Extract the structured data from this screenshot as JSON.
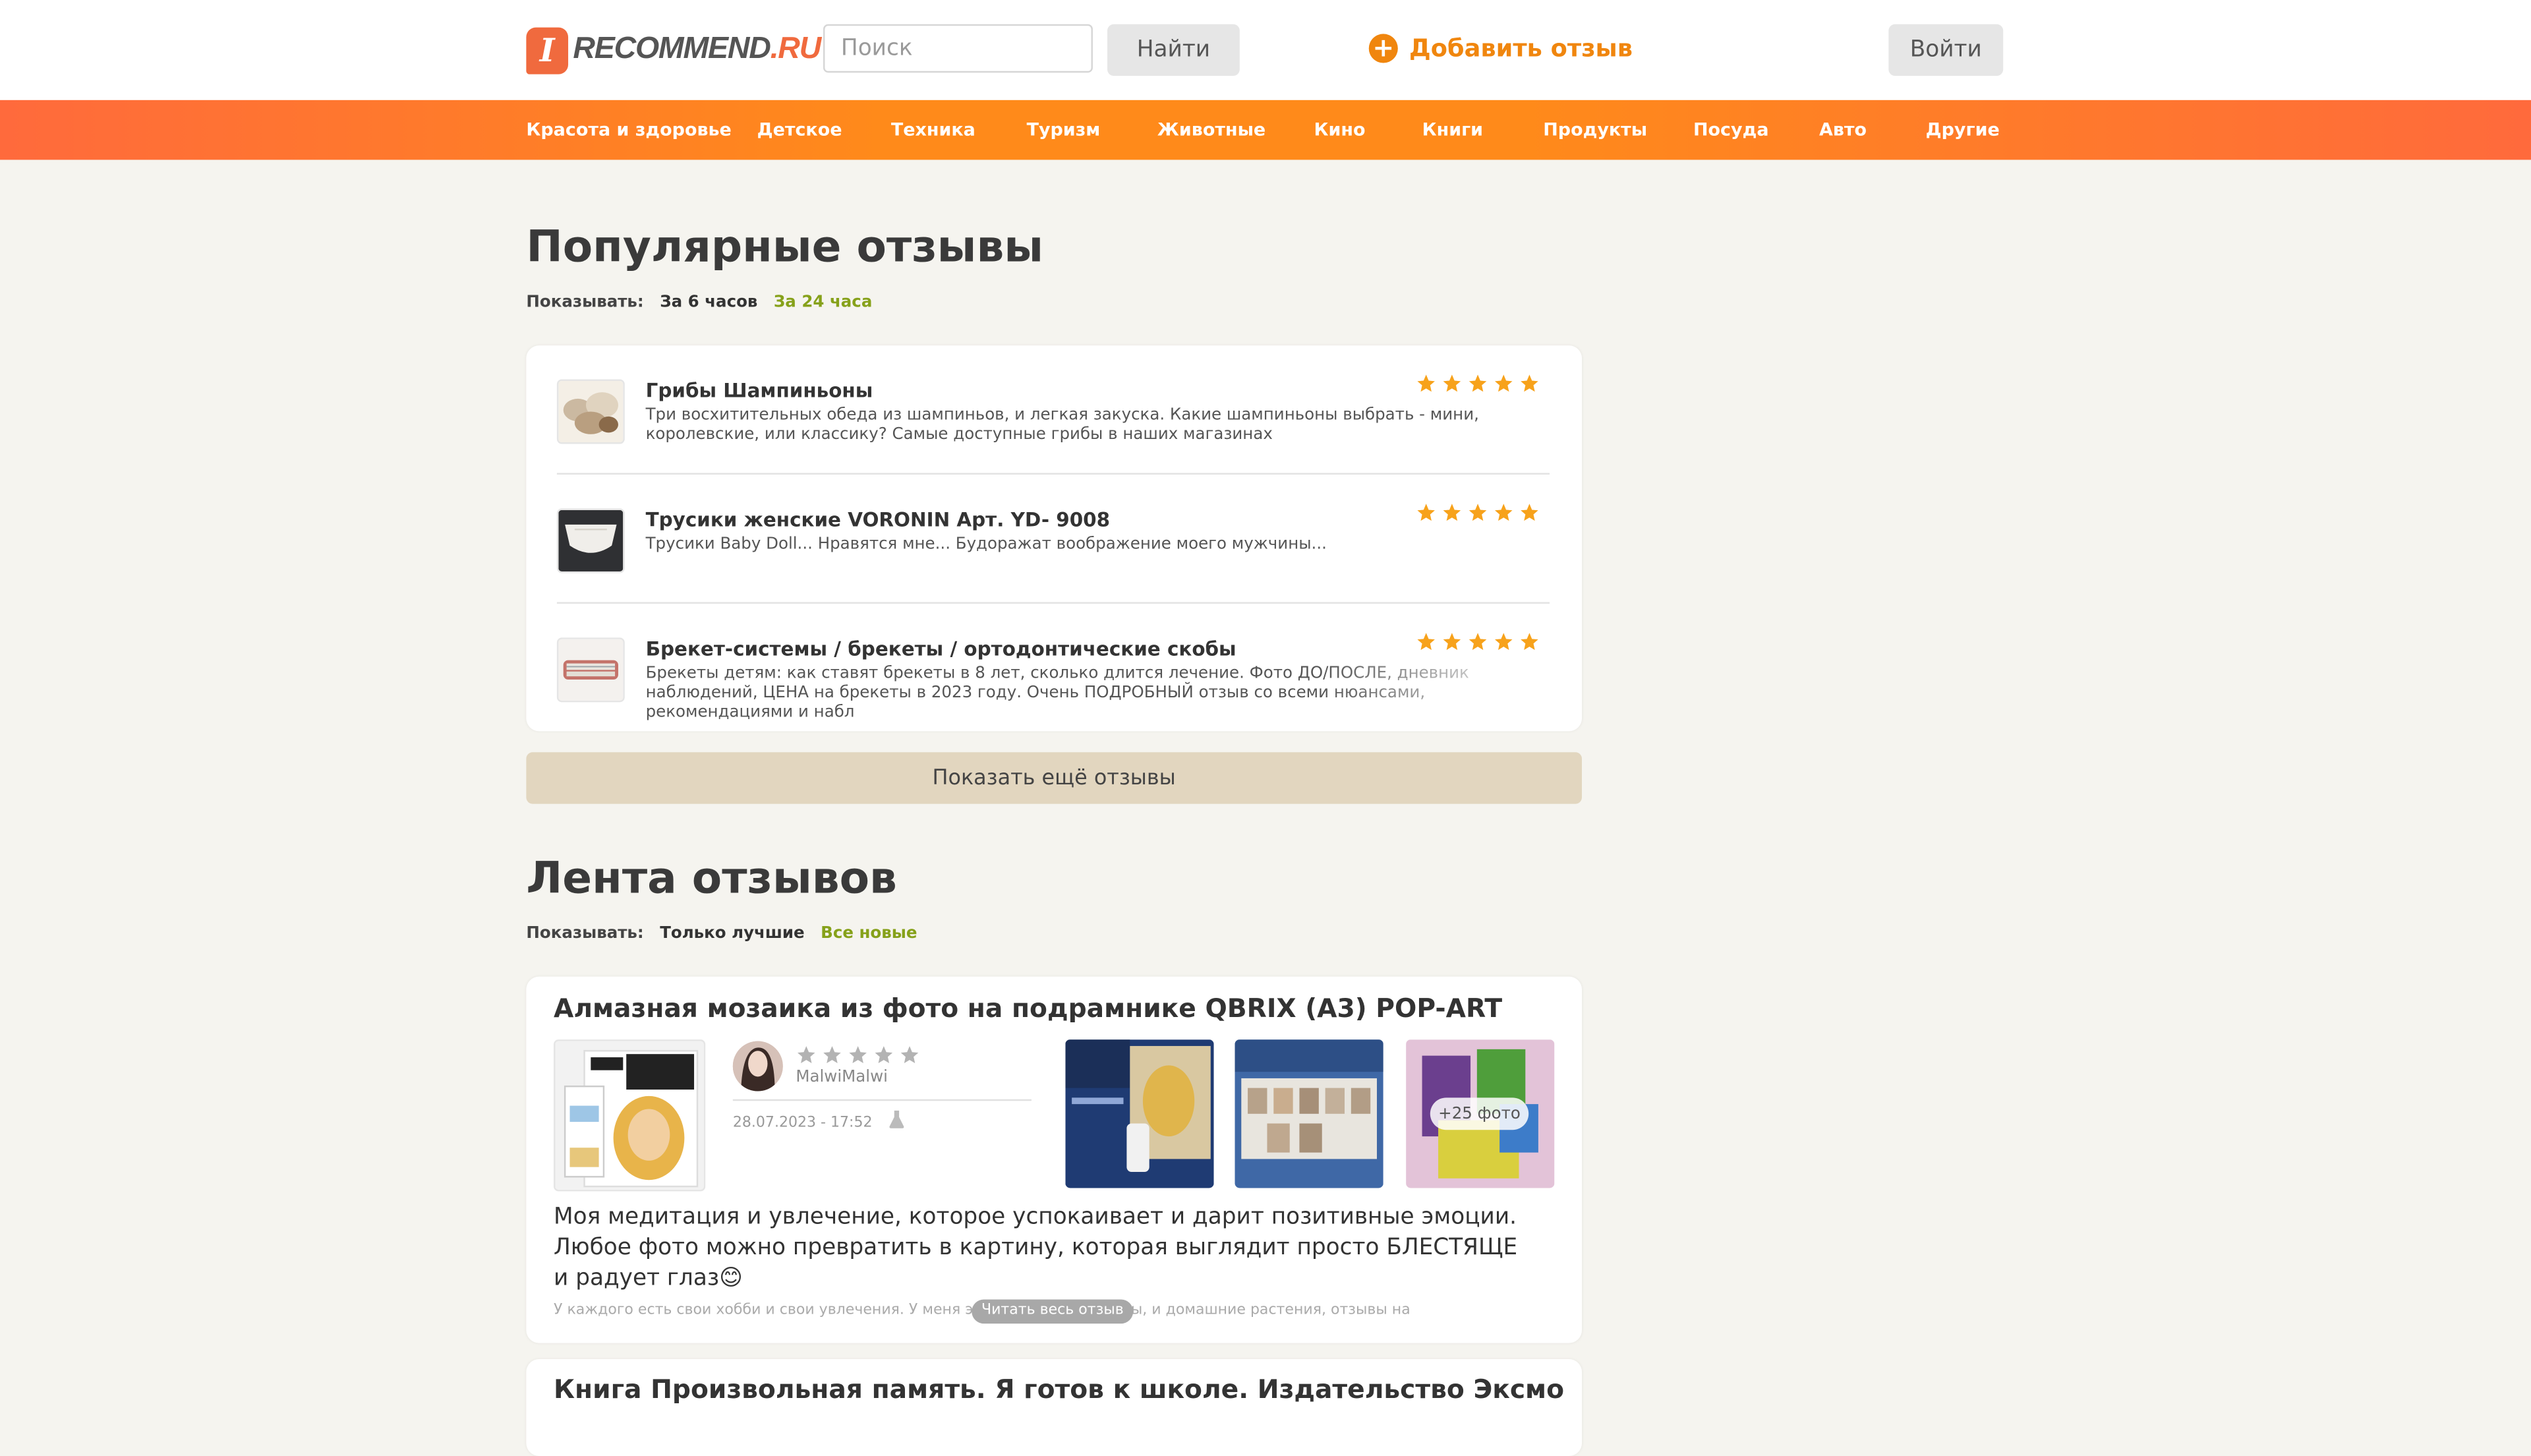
{
  "header": {
    "logo_letter": "I",
    "logo_main": "RECOMMEND",
    "logo_tld": ".RU",
    "search_placeholder": "Поиск",
    "search_button": "Найти",
    "add_review": "Добавить отзыв",
    "login_button": "Войти",
    "accent_color": "#f06a3e"
  },
  "nav": {
    "items": [
      "Красота и здоровье",
      "Детское",
      "Техника",
      "Туризм",
      "Животные",
      "Кино",
      "Книги",
      "Продукты",
      "Посуда",
      "Авто",
      "Другие"
    ]
  },
  "popular": {
    "title": "Популярные отзывы",
    "filter_label": "Показывать:",
    "filter_options": [
      "За 6 часов",
      "За 24 часа"
    ],
    "active_filter": "За 24 часа",
    "items": [
      {
        "title": "Грибы Шампиньоны",
        "text": "Три восхитительных обеда из шампиньов, и легкая закуска. Какие шампиньоны выбрать - мини, королевские, или классику? Самые доступные грибы в наших магазинах",
        "rating": 5
      },
      {
        "title": "Трусики женские VORONIN Арт. YD- 9008",
        "text": "Трусики Baby Doll... Нравятся мне... Будоражат воображение моего мужчины...",
        "rating": 5
      },
      {
        "title": "Брекет-системы / брекеты / ортодонтические скобы",
        "text": "Брекеты детям: как ставят брекеты в 8 лет, сколько длится лечение. Фото ДО/ПОСЛЕ, дневник наблюдений, ЦЕНА на брекеты в 2023 году. Очень ПОДРОБНЫЙ отзыв со всеми нюансами, рекомендациями и набл",
        "rating": 5
      }
    ],
    "more_button": "Показать ещё отзывы"
  },
  "feed": {
    "title": "Лента отзывов",
    "filter_label": "Показывать:",
    "filter_options": [
      "Только лучшие",
      "Все новые"
    ],
    "active_filter": "Все новые",
    "reviews": [
      {
        "title": "Алмазная мозаика из фото на подрамнике QBRIX (А3) POP-ART",
        "rating": 5,
        "username": "MalwiMalwi",
        "date": "28.07.2023 - 17:52",
        "more_photos": "+25 фото",
        "teaser": "Моя медитация и увлечение, которое успокаивает и дарит позитивные эмоции. Любое фото можно превратить в картину, которая выглядит просто БЛЕСТЯЩЕ и радует глаз😊",
        "snippet": "У каждого есть свои хобби и свои увлечения. У меня это и книги, и сериалы, и домашние растения, отзывы на",
        "read_button": "Читать весь отзыв"
      },
      {
        "title": "Книга Произвольная память. Я готов к школе. Издательство Эксмо"
      }
    ]
  }
}
